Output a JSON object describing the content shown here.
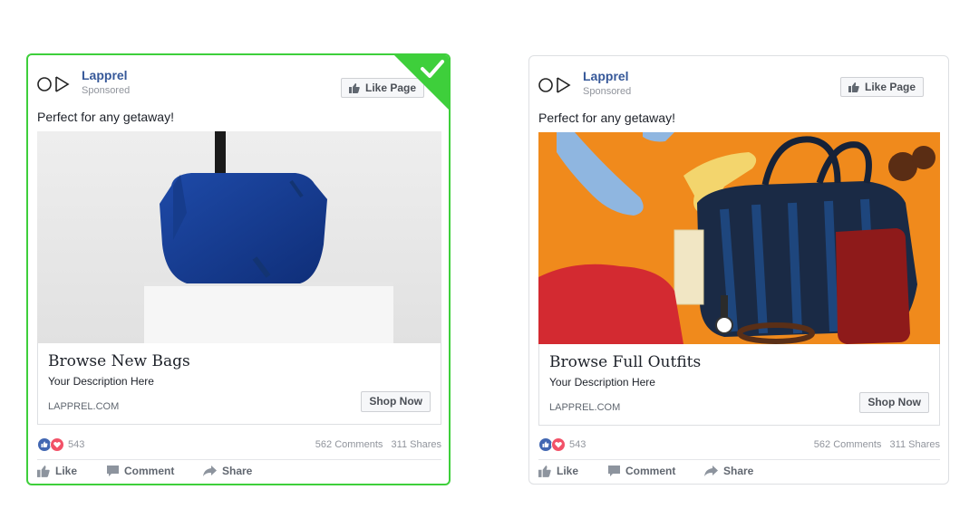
{
  "colors": {
    "selected_border": "#3ecf3b",
    "page_name": "#365899",
    "like_blue": "#4267b2",
    "love_red": "#f25268"
  },
  "ads": [
    {
      "selected": true,
      "page_name": "Lapprel",
      "sponsored": "Sponsored",
      "like_page": "Like Page",
      "post_text": "Perfect for any getaway!",
      "image_desc": "navy-mesh-handbag-on-white-pedestal",
      "link_title": "Browse New Bags",
      "link_description": "Your Description Here",
      "link_url": "LAPPREL.COM",
      "cta": "Shop Now",
      "reactions": "543",
      "comments": "562 Comments",
      "shares": "311 Shares",
      "actions": {
        "like": "Like",
        "comment": "Comment",
        "share": "Share"
      }
    },
    {
      "selected": false,
      "page_name": "Lapprel",
      "sponsored": "Sponsored",
      "like_page": "Like Page",
      "post_text": "Perfect for any getaway!",
      "image_desc": "outfit-flatlay-on-orange-background",
      "link_title": "Browse Full Outfits",
      "link_description": "Your Description Here",
      "link_url": "LAPPREL.COM",
      "cta": "Shop Now",
      "reactions": "543",
      "comments": "562 Comments",
      "shares": "311 Shares",
      "actions": {
        "like": "Like",
        "comment": "Comment",
        "share": "Share"
      }
    }
  ]
}
